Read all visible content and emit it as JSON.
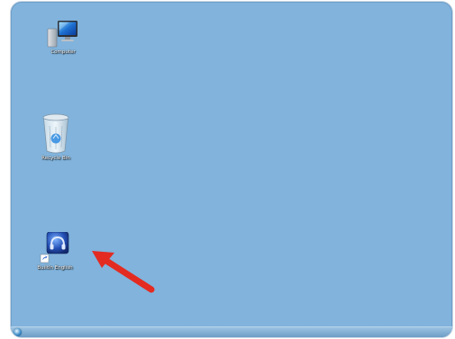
{
  "desktop": {
    "icons": [
      {
        "label": "Computer",
        "icon": "computer-icon"
      },
      {
        "label": "Recycle Bin",
        "icon": "recycle-bin-icon"
      },
      {
        "label": "BuiltIn English",
        "icon": "headset-app-shortcut-icon"
      }
    ],
    "background_color": "#81b3dc"
  },
  "taskbar": {
    "start_button": "start-orb-icon"
  },
  "annotation": {
    "arrow_color": "#e32b22"
  }
}
